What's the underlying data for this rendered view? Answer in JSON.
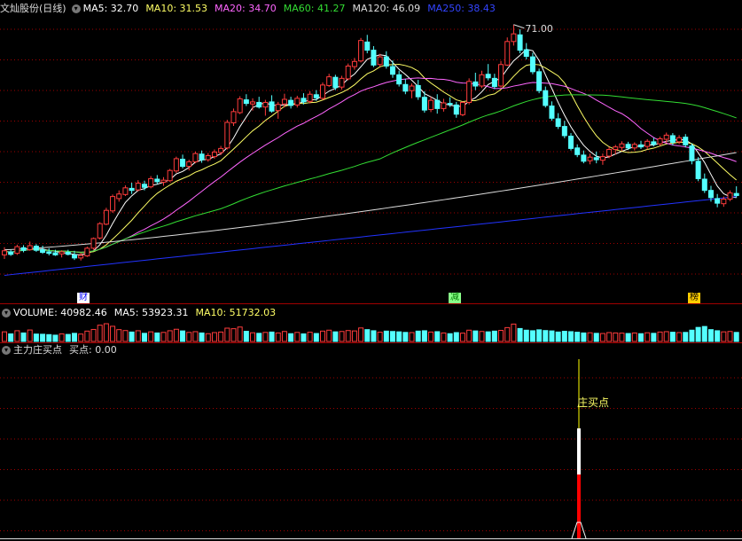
{
  "panel_main": {
    "title": "文灿股份(日线)",
    "ma5": "MA5: 32.70",
    "ma10": "MA10: 31.53",
    "ma20": "MA20: 34.70",
    "ma60": "MA60: 41.27",
    "ma120": "MA120: 46.09",
    "ma250": "MA250: 38.43",
    "high_label": "71.00",
    "tags": [
      "财",
      "减",
      "榜"
    ]
  },
  "panel_volume": {
    "title": "VOLUME: 40982.46",
    "ma5": "MA5: 53923.31",
    "ma10": "MA10: 51732.03"
  },
  "panel_indicator": {
    "title": "主力庄买点",
    "value": "买点: 0.00",
    "signal_label": "庄买点"
  },
  "colors": {
    "up": "#ff3c3c",
    "down": "#54ffff",
    "ma5": "#ffffff",
    "ma10": "#ffff66",
    "ma20": "#ff66ff",
    "ma60": "#33dd33",
    "ma120": "#dddddd",
    "ma250": "#2233ff",
    "grid": "#a00000",
    "signal_red": "#ff0000"
  },
  "chart_data": {
    "type": "candlestick",
    "title": "文灿股份(日线)",
    "ohlc": [
      [
        26.0,
        27.5,
        25.2,
        26.8
      ],
      [
        26.6,
        27.0,
        25.8,
        26.1
      ],
      [
        26.3,
        28.0,
        26.0,
        27.6
      ],
      [
        27.4,
        27.9,
        26.5,
        26.9
      ],
      [
        27.0,
        28.6,
        26.8,
        27.8
      ],
      [
        27.7,
        28.1,
        26.6,
        26.9
      ],
      [
        27.0,
        27.8,
        26.2,
        26.5
      ],
      [
        26.6,
        27.3,
        25.9,
        26.3
      ],
      [
        26.4,
        27.0,
        25.8,
        26.0
      ],
      [
        26.2,
        26.9,
        25.5,
        26.6
      ],
      [
        26.5,
        27.0,
        25.9,
        26.1
      ],
      [
        26.0,
        26.8,
        25.0,
        25.4
      ],
      [
        25.4,
        26.3,
        24.9,
        25.9
      ],
      [
        25.8,
        27.6,
        25.6,
        27.3
      ],
      [
        27.3,
        29.4,
        27.0,
        29.2
      ],
      [
        29.3,
        32.4,
        29.0,
        32.1
      ],
      [
        32.0,
        35.2,
        31.8,
        34.7
      ],
      [
        34.6,
        37.8,
        34.2,
        37.4
      ],
      [
        37.0,
        38.6,
        36.4,
        37.9
      ],
      [
        37.8,
        39.6,
        37.5,
        39.1
      ],
      [
        39.0,
        40.1,
        37.9,
        38.6
      ],
      [
        38.7,
        40.6,
        38.4,
        40.0
      ],
      [
        39.8,
        40.5,
        38.6,
        39.2
      ],
      [
        39.3,
        41.4,
        39.0,
        40.9
      ],
      [
        40.8,
        41.6,
        39.8,
        40.3
      ],
      [
        40.2,
        41.2,
        39.5,
        40.6
      ],
      [
        40.5,
        42.8,
        40.3,
        42.5
      ],
      [
        42.4,
        45.2,
        42.0,
        44.8
      ],
      [
        44.7,
        45.6,
        42.9,
        43.3
      ],
      [
        43.3,
        44.6,
        42.5,
        44.2
      ],
      [
        44.2,
        46.2,
        43.9,
        45.8
      ],
      [
        45.7,
        46.4,
        44.0,
        44.6
      ],
      [
        44.6,
        45.9,
        44.2,
        45.4
      ],
      [
        45.2,
        46.6,
        44.8,
        46.1
      ],
      [
        46.0,
        47.3,
        45.5,
        46.8
      ],
      [
        46.9,
        52.4,
        46.6,
        51.9
      ],
      [
        51.8,
        54.6,
        51.2,
        54.0
      ],
      [
        53.8,
        57.0,
        53.5,
        56.5
      ],
      [
        56.3,
        57.4,
        55.1,
        55.6
      ],
      [
        55.5,
        56.6,
        54.2,
        55.9
      ],
      [
        55.8,
        56.9,
        54.6,
        54.9
      ],
      [
        54.9,
        56.3,
        53.2,
        55.8
      ],
      [
        55.9,
        57.2,
        53.8,
        54.1
      ],
      [
        54.2,
        55.9,
        52.6,
        55.4
      ],
      [
        55.5,
        57.5,
        54.8,
        56.4
      ],
      [
        56.2,
        56.9,
        54.6,
        55.2
      ],
      [
        55.3,
        57.1,
        54.8,
        56.6
      ],
      [
        56.6,
        57.6,
        55.4,
        55.9
      ],
      [
        56.0,
        58.0,
        55.6,
        57.4
      ],
      [
        57.3,
        58.2,
        56.1,
        56.7
      ],
      [
        56.6,
        59.7,
        56.3,
        59.2
      ],
      [
        59.1,
        61.4,
        58.8,
        60.8
      ],
      [
        60.7,
        61.2,
        58.2,
        58.7
      ],
      [
        58.8,
        61.0,
        58.3,
        60.5
      ],
      [
        60.4,
        63.4,
        60.1,
        62.9
      ],
      [
        62.8,
        64.5,
        62.2,
        63.8
      ],
      [
        63.9,
        68.4,
        63.6,
        67.9
      ],
      [
        67.6,
        69.0,
        65.4,
        66.0
      ],
      [
        66.0,
        66.8,
        62.7,
        63.1
      ],
      [
        63.2,
        65.3,
        62.8,
        64.7
      ],
      [
        64.7,
        65.8,
        62.4,
        62.9
      ],
      [
        62.8,
        64.0,
        60.6,
        61.3
      ],
      [
        61.2,
        62.0,
        58.9,
        59.4
      ],
      [
        59.3,
        60.4,
        57.4,
        58.0
      ],
      [
        58.1,
        59.5,
        56.6,
        59.0
      ],
      [
        59.1,
        60.2,
        56.3,
        56.9
      ],
      [
        56.8,
        58.0,
        53.8,
        54.3
      ],
      [
        54.4,
        56.9,
        53.9,
        56.2
      ],
      [
        56.2,
        57.4,
        53.6,
        54.6
      ],
      [
        54.6,
        56.5,
        54.0,
        55.7
      ],
      [
        55.6,
        56.8,
        54.9,
        55.4
      ],
      [
        55.3,
        55.9,
        52.8,
        53.5
      ],
      [
        53.4,
        56.0,
        53.1,
        55.8
      ],
      [
        55.8,
        60.5,
        55.4,
        59.9
      ],
      [
        59.8,
        61.6,
        58.2,
        59.0
      ],
      [
        59.0,
        62.0,
        58.6,
        61.2
      ],
      [
        61.3,
        63.3,
        60.1,
        60.6
      ],
      [
        60.5,
        61.4,
        58.4,
        58.9
      ],
      [
        59.0,
        63.9,
        58.7,
        63.2
      ],
      [
        63.1,
        68.5,
        62.9,
        67.7
      ],
      [
        67.7,
        71.0,
        66.9,
        69.2
      ],
      [
        69.0,
        70.1,
        65.4,
        66.0
      ],
      [
        66.1,
        67.4,
        64.2,
        64.8
      ],
      [
        64.7,
        65.5,
        61.3,
        61.8
      ],
      [
        61.8,
        62.4,
        57.6,
        58.1
      ],
      [
        58.1,
        58.9,
        54.8,
        55.2
      ],
      [
        55.1,
        56.0,
        52.2,
        52.7
      ],
      [
        52.6,
        53.7,
        50.6,
        51.1
      ],
      [
        51.1,
        52.2,
        48.8,
        49.3
      ],
      [
        49.2,
        49.8,
        46.4,
        46.8
      ],
      [
        46.9,
        47.6,
        45.1,
        45.6
      ],
      [
        45.5,
        46.4,
        43.9,
        44.3
      ],
      [
        44.4,
        45.8,
        43.7,
        45.1
      ],
      [
        45.0,
        46.2,
        43.9,
        44.6
      ],
      [
        44.5,
        45.8,
        43.6,
        45.2
      ],
      [
        45.3,
        47.1,
        44.9,
        46.6
      ],
      [
        46.6,
        47.5,
        45.6,
        47.1
      ],
      [
        47.0,
        48.2,
        46.3,
        47.7
      ],
      [
        47.6,
        48.1,
        46.5,
        46.9
      ],
      [
        46.9,
        48.0,
        46.4,
        47.6
      ],
      [
        47.5,
        48.3,
        46.7,
        47.1
      ],
      [
        47.2,
        48.6,
        46.6,
        48.2
      ],
      [
        48.1,
        48.9,
        47.2,
        47.6
      ],
      [
        47.7,
        49.1,
        47.3,
        48.7
      ],
      [
        48.6,
        49.9,
        47.9,
        49.4
      ],
      [
        49.3,
        49.8,
        47.4,
        48.0
      ],
      [
        48.1,
        49.4,
        47.6,
        48.9
      ],
      [
        49.0,
        49.6,
        47.0,
        47.5
      ],
      [
        47.3,
        47.8,
        43.7,
        44.4
      ],
      [
        44.3,
        45.1,
        40.4,
        40.9
      ],
      [
        40.8,
        41.9,
        38.1,
        38.6
      ],
      [
        38.6,
        39.5,
        36.4,
        37.2
      ],
      [
        37.0,
        37.9,
        35.3,
        36.1
      ],
      [
        36.0,
        37.4,
        35.4,
        36.9
      ],
      [
        36.9,
        38.6,
        36.5,
        38.1
      ],
      [
        38.0,
        39.4,
        37.2,
        37.6
      ]
    ],
    "series": [
      {
        "name": "MA5",
        "color": "#ffffff"
      },
      {
        "name": "MA10",
        "color": "#ffff66"
      },
      {
        "name": "MA20",
        "color": "#ff66ff"
      },
      {
        "name": "MA60",
        "color": "#33dd33"
      },
      {
        "name": "MA120",
        "color": "#dddddd"
      },
      {
        "name": "MA250",
        "color": "#2233ff"
      }
    ],
    "annotations": [
      {
        "label": "71.00",
        "value": 71.0
      }
    ],
    "volume_title": "VOLUME",
    "volume": [
      5.2,
      4.1,
      5.8,
      4.6,
      6.2,
      4.0,
      3.9,
      3.7,
      3.4,
      4.1,
      3.8,
      4.4,
      4.0,
      5.6,
      6.5,
      8.8,
      9.6,
      8.2,
      6.4,
      5.9,
      5.1,
      5.8,
      4.4,
      5.2,
      4.6,
      4.9,
      5.8,
      6.6,
      5.7,
      4.9,
      5.3,
      4.6,
      4.2,
      4.8,
      5.1,
      7.2,
      6.9,
      7.8,
      5.5,
      4.7,
      4.4,
      4.9,
      5.1,
      4.6,
      5.4,
      4.2,
      4.9,
      4.1,
      5.0,
      4.3,
      5.6,
      6.1,
      5.2,
      5.4,
      5.9,
      5.7,
      7.3,
      6.4,
      5.8,
      5.0,
      5.6,
      5.4,
      5.2,
      4.9,
      4.8,
      5.6,
      5.8,
      5.1,
      5.3,
      4.6,
      4.2,
      4.8,
      4.5,
      6.1,
      5.7,
      5.4,
      5.2,
      5.6,
      6.0,
      7.5,
      9.4,
      7.0,
      6.1,
      5.8,
      6.3,
      5.9,
      5.7,
      5.1,
      5.5,
      5.3,
      5.0,
      4.6,
      4.7,
      4.4,
      4.3,
      4.8,
      4.6,
      4.5,
      4.3,
      4.6,
      4.2,
      4.7,
      4.4,
      5.1,
      5.3,
      5.0,
      4.8,
      4.9,
      6.1,
      7.6,
      8.1,
      6.4,
      5.8,
      5.2,
      5.4,
      4.9
    ],
    "signal_index": 81
  }
}
